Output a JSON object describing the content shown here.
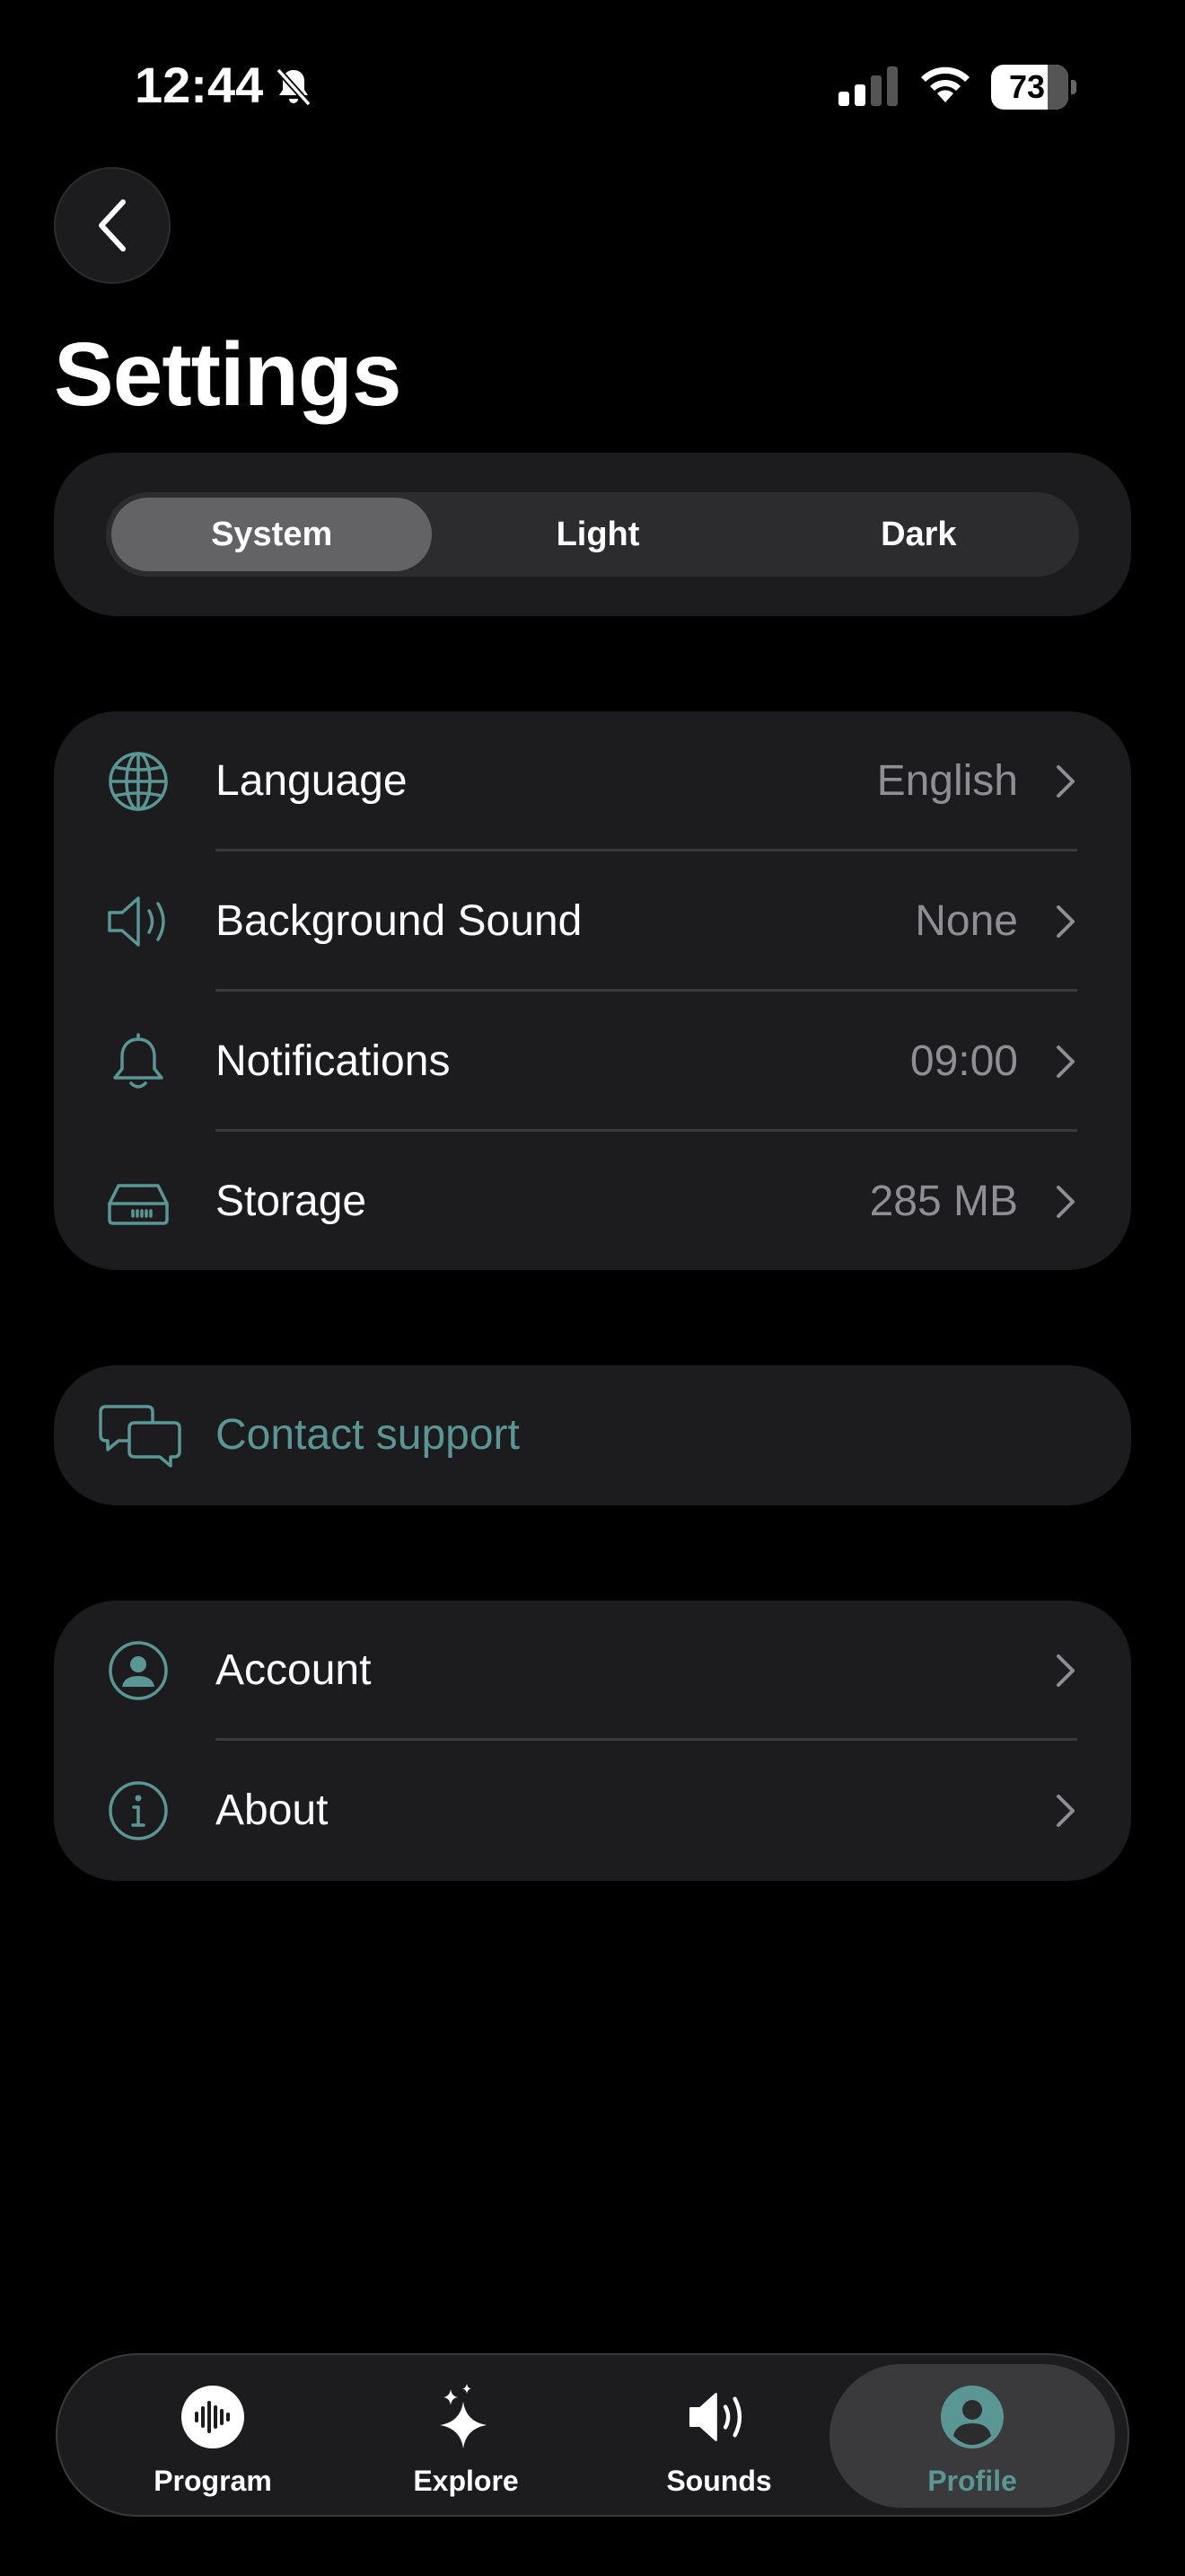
{
  "status_bar": {
    "time": "12:44",
    "battery": "73"
  },
  "page": {
    "title": "Settings"
  },
  "theme": {
    "options": [
      "System",
      "Light",
      "Dark"
    ],
    "selected": "System"
  },
  "settings_group": {
    "items": [
      {
        "label": "Language",
        "value": "English",
        "icon": "globe-icon"
      },
      {
        "label": "Background Sound",
        "value": "None",
        "icon": "speaker-icon"
      },
      {
        "label": "Notifications",
        "value": "09:00",
        "icon": "bell-icon"
      },
      {
        "label": "Storage",
        "value": "285 MB",
        "icon": "storage-drive-icon"
      }
    ]
  },
  "support": {
    "label": "Contact support",
    "icon": "chat-bubbles-icon"
  },
  "account_group": {
    "items": [
      {
        "label": "Account",
        "icon": "person-circle-icon"
      },
      {
        "label": "About",
        "icon": "info-circle-icon"
      }
    ]
  },
  "tab_bar": {
    "items": [
      {
        "label": "Program",
        "icon": "waveform-icon"
      },
      {
        "label": "Explore",
        "icon": "sparkles-icon"
      },
      {
        "label": "Sounds",
        "icon": "speaker-wave-icon"
      },
      {
        "label": "Profile",
        "icon": "profile-icon"
      }
    ],
    "active": "Profile"
  },
  "colors": {
    "accent": "#5a9693",
    "background": "#000000",
    "card": "#1c1c1e",
    "secondary_text": "#8e8e93"
  }
}
